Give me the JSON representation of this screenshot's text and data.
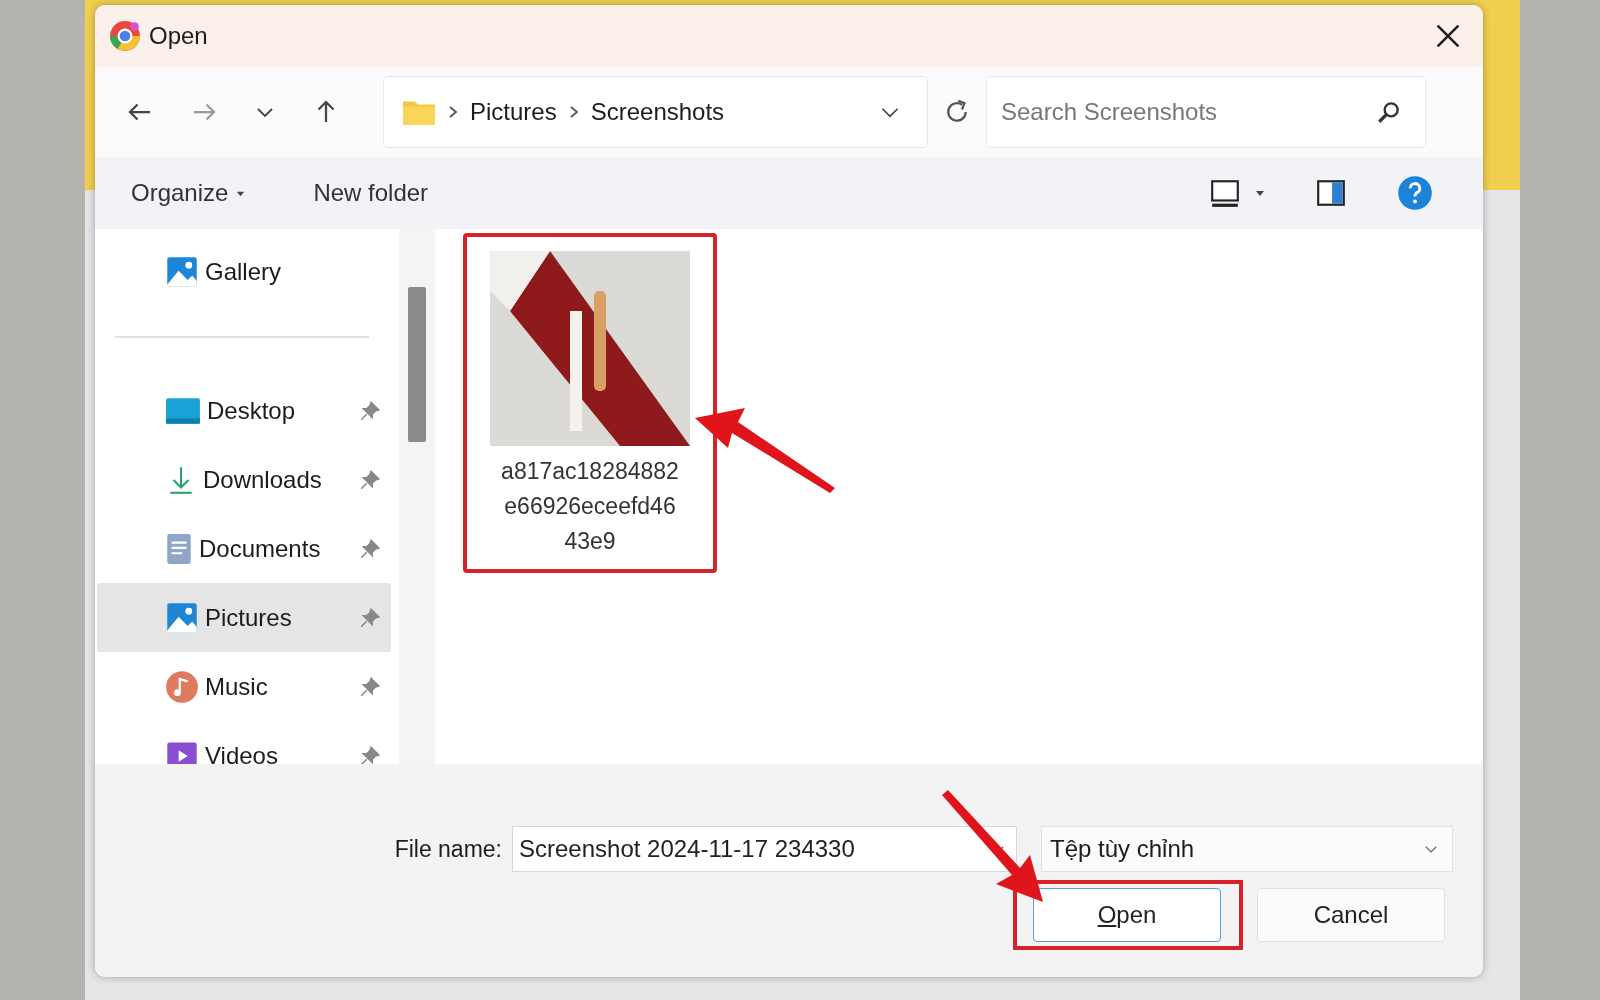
{
  "window": {
    "title": "Open"
  },
  "address": {
    "breadcrumb": [
      "Pictures",
      "Screenshots"
    ]
  },
  "search": {
    "placeholder": "Search Screenshots"
  },
  "toolbar": {
    "items": [
      "Organize",
      "New folder"
    ]
  },
  "sidebar": {
    "items": [
      {
        "label": "Gallery",
        "kind": "gallery",
        "pinned": false,
        "selected": false
      },
      {
        "label": "Desktop",
        "kind": "desktop",
        "pinned": true,
        "selected": false
      },
      {
        "label": "Downloads",
        "kind": "downloads",
        "pinned": true,
        "selected": false
      },
      {
        "label": "Documents",
        "kind": "documents",
        "pinned": true,
        "selected": false
      },
      {
        "label": "Pictures",
        "kind": "pictures",
        "pinned": true,
        "selected": true
      },
      {
        "label": "Music",
        "kind": "music",
        "pinned": true,
        "selected": false
      },
      {
        "label": "Videos",
        "kind": "videos",
        "pinned": true,
        "selected": false
      }
    ]
  },
  "files": [
    {
      "name": "a817ac18284882e66926eceefd4643e9",
      "highlighted": true
    }
  ],
  "footer": {
    "file_name_label": "File name:",
    "file_name": "Screenshot 2024-11-17 234330",
    "file_type": "Tệp tùy chỉnh",
    "buttons": [
      {
        "label": "Open",
        "kind": "primary",
        "highlighted": true
      },
      {
        "label": "Cancel",
        "kind": "secondary",
        "highlighted": false
      }
    ]
  }
}
